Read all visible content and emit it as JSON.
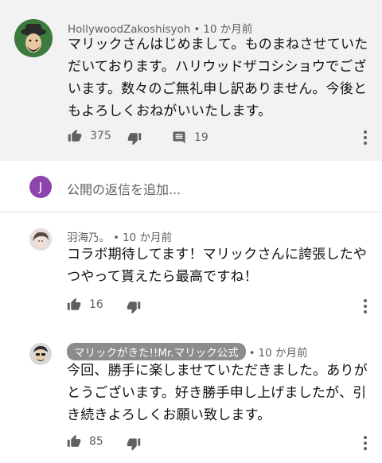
{
  "comments": [
    {
      "author": "HollywoodZakoshisyoh",
      "time": "10 か月前",
      "text_lines": [
        "マリックさんはじめまして。ものまねさせていた",
        "だいております。ハリウッドザコシショウでござ",
        "います。数々のご無礼申し訳ありません。今後と",
        "もよろしくおねがいいたします。"
      ],
      "likes": "375",
      "replies": "19"
    },
    {
      "author": "羽海乃。",
      "time": "10 か月前",
      "text_lines": [
        "コラボ期待してます！マリックさんに誇張したや",
        "つやって貰えたら最高ですね！"
      ],
      "likes": "16"
    },
    {
      "author": "マリックがきた!!Mr.マリック公式",
      "time": "10 か月前",
      "text_lines": [
        "今回、勝手に楽しませていただきました。ありが",
        "とうございます。好き勝手申し上げましたが、引",
        "き続きよろしくお願い致します。"
      ],
      "likes": "85"
    }
  ],
  "reply_box": {
    "avatar_letter": "J",
    "placeholder": "公開の返信を追加..."
  },
  "meta_separator": "•"
}
